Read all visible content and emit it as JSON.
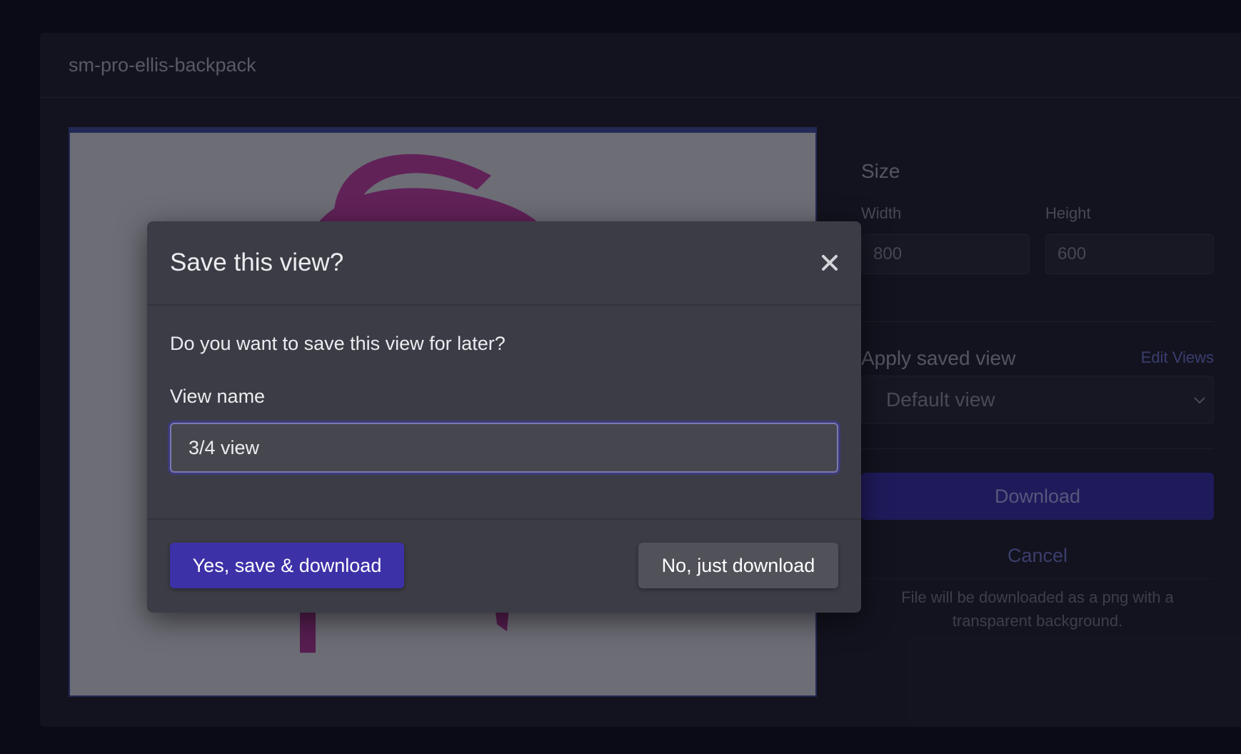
{
  "panel": {
    "title": "sm-pro-ellis-backpack"
  },
  "sidebar": {
    "size_heading": "Size",
    "width_label": "Width",
    "width_value": "800",
    "height_label": "Height",
    "height_value": "600",
    "apply_label": "Apply saved view",
    "edit_views_label": "Edit Views",
    "selected_view": "Default view",
    "download_label": "Download",
    "cancel_label": "Cancel",
    "note": "File will be downloaded as a png with a transparent background."
  },
  "modal": {
    "title": "Save this view?",
    "question": "Do you want to save this view for later?",
    "view_name_label": "View name",
    "view_name_value": "3/4 view",
    "confirm_label": "Yes, save & download",
    "decline_label": "No, just download",
    "close_icon": "close-icon"
  },
  "colors": {
    "accent": "#3d31a8",
    "modal_bg": "#3c3c46",
    "backpack": "#7a2a6c"
  }
}
